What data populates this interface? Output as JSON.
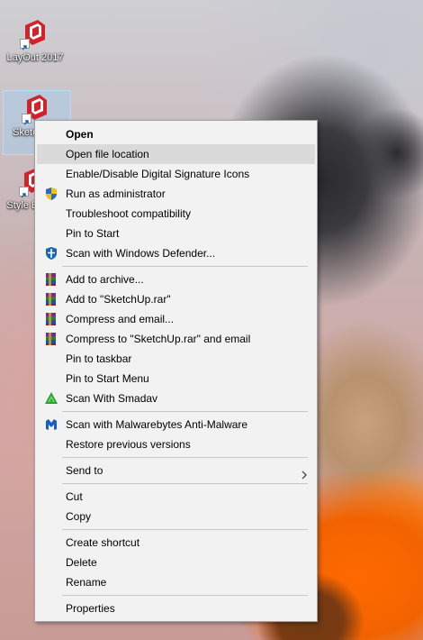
{
  "desktop": {
    "icons": [
      {
        "label": "LayOut 2017",
        "icon": "layout-app-icon"
      },
      {
        "label": "Sketc… 20",
        "icon": "sketchup-app-icon"
      },
      {
        "label": "Style B… 20",
        "icon": "style-builder-app-icon"
      }
    ]
  },
  "menu": {
    "groups": [
      [
        {
          "label": "Open",
          "bold": true
        },
        {
          "label": "Open file location",
          "hover": true
        },
        {
          "label": "Enable/Disable Digital Signature Icons"
        },
        {
          "label": "Run as administrator",
          "icon": "uac-shield-icon"
        },
        {
          "label": "Troubleshoot compatibility"
        },
        {
          "label": "Pin to Start"
        },
        {
          "label": "Scan with Windows Defender...",
          "icon": "windows-defender-icon"
        }
      ],
      [
        {
          "label": "Add to archive...",
          "icon": "winrar-icon"
        },
        {
          "label": "Add to \"SketchUp.rar\"",
          "icon": "winrar-icon"
        },
        {
          "label": "Compress and email...",
          "icon": "winrar-icon"
        },
        {
          "label": "Compress to \"SketchUp.rar\" and email",
          "icon": "winrar-icon"
        },
        {
          "label": "Pin to taskbar"
        },
        {
          "label": "Pin to Start Menu"
        },
        {
          "label": "Scan With Smadav",
          "icon": "smadav-icon"
        }
      ],
      [
        {
          "label": "Scan with Malwarebytes Anti-Malware",
          "icon": "malwarebytes-icon"
        },
        {
          "label": "Restore previous versions"
        }
      ],
      [
        {
          "label": "Send to",
          "submenu": true
        }
      ],
      [
        {
          "label": "Cut"
        },
        {
          "label": "Copy"
        }
      ],
      [
        {
          "label": "Create shortcut"
        },
        {
          "label": "Delete"
        },
        {
          "label": "Rename"
        }
      ],
      [
        {
          "label": "Properties"
        }
      ]
    ]
  },
  "colors": {
    "menu_bg": "#f2f2f2",
    "hover_bg": "#dadada",
    "sketchup_red": "#d2232a"
  }
}
